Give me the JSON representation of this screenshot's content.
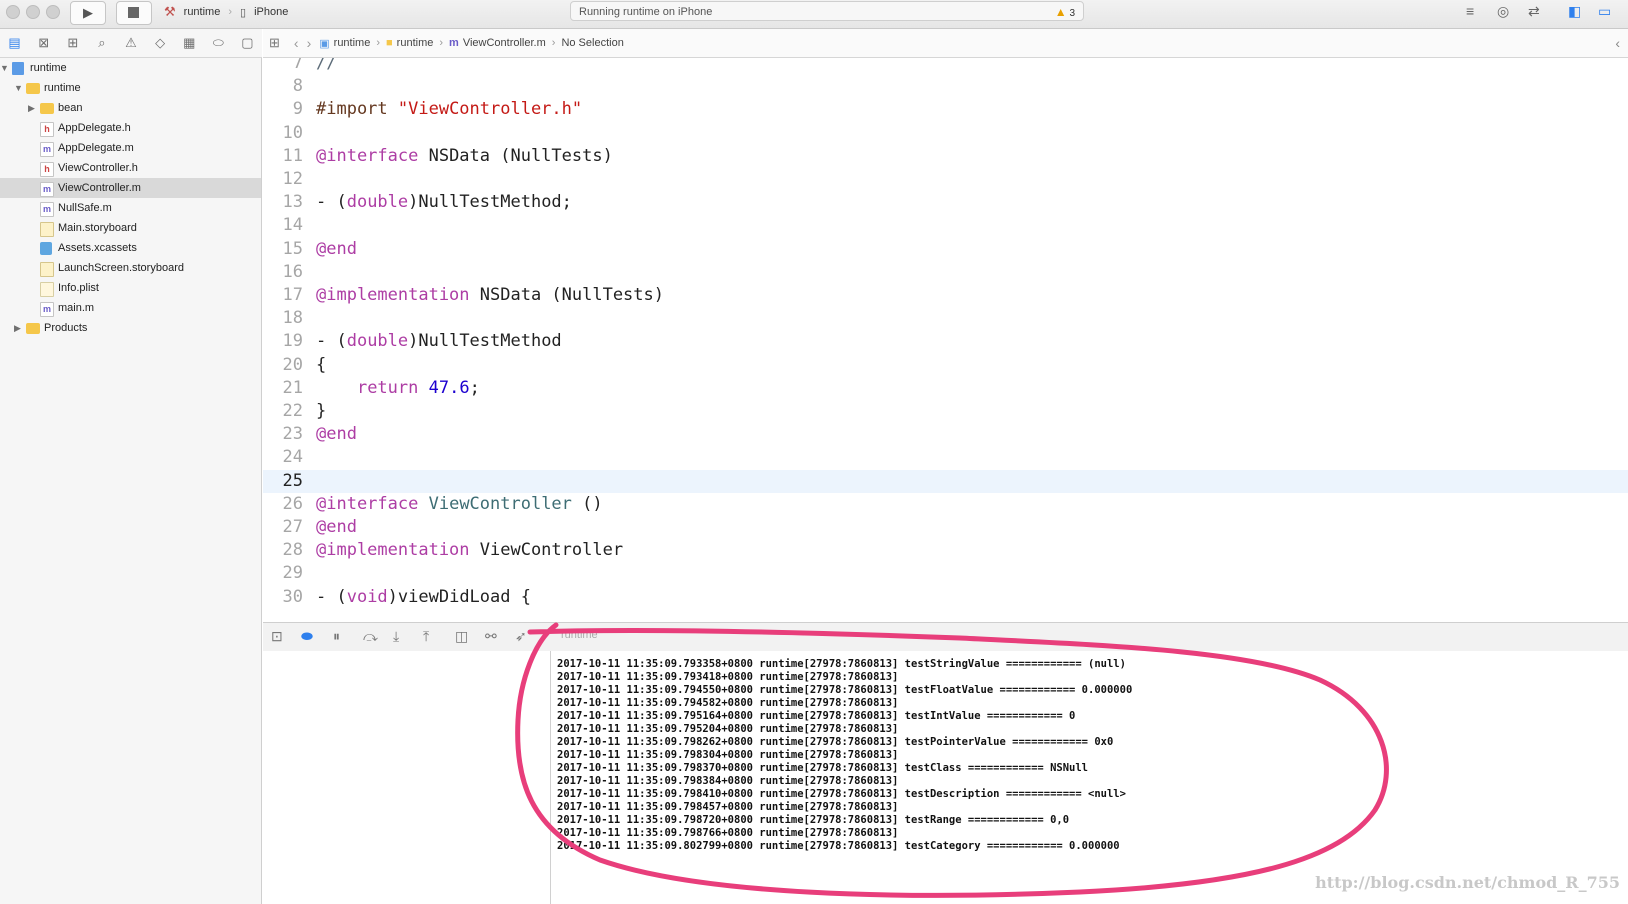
{
  "toolbar": {
    "scheme": "runtime",
    "device": "iPhone",
    "activity": "Running runtime on iPhone",
    "warnings": "3"
  },
  "navigator": {
    "items": [
      {
        "label": "runtime",
        "icon": "project-icon",
        "kind": "proj",
        "indent": 0,
        "disclosure": "▼",
        "selected": false
      },
      {
        "label": "runtime",
        "icon": "folder-icon",
        "kind": "folder",
        "indent": 1,
        "disclosure": "▼",
        "selected": false
      },
      {
        "label": "bean",
        "icon": "folder-icon",
        "kind": "folder",
        "indent": 2,
        "disclosure": "▶",
        "selected": false
      },
      {
        "label": "AppDelegate.h",
        "icon": "header-file-icon",
        "kind": "h",
        "glyph": "h",
        "indent": 2,
        "selected": false
      },
      {
        "label": "AppDelegate.m",
        "icon": "objc-file-icon",
        "kind": "m",
        "glyph": "m",
        "indent": 2,
        "selected": false
      },
      {
        "label": "ViewController.h",
        "icon": "header-file-icon",
        "kind": "h",
        "glyph": "h",
        "indent": 2,
        "selected": false
      },
      {
        "label": "ViewController.m",
        "icon": "objc-file-icon",
        "kind": "m",
        "glyph": "m",
        "indent": 2,
        "selected": true
      },
      {
        "label": "NullSafe.m",
        "icon": "objc-file-icon",
        "kind": "m",
        "glyph": "m",
        "indent": 2,
        "selected": false
      },
      {
        "label": "Main.storyboard",
        "icon": "storyboard-icon",
        "kind": "sb",
        "indent": 2,
        "selected": false
      },
      {
        "label": "Assets.xcassets",
        "icon": "asset-catalog-icon",
        "kind": "assets",
        "indent": 2,
        "selected": false
      },
      {
        "label": "LaunchScreen.storyboard",
        "icon": "storyboard-icon",
        "kind": "sb",
        "indent": 2,
        "selected": false
      },
      {
        "label": "Info.plist",
        "icon": "plist-icon",
        "kind": "plist",
        "indent": 2,
        "selected": false
      },
      {
        "label": "main.m",
        "icon": "objc-file-icon",
        "kind": "m",
        "glyph": "m",
        "indent": 2,
        "selected": false
      },
      {
        "label": "Products",
        "icon": "folder-icon",
        "kind": "folder",
        "indent": 1,
        "disclosure": "▶",
        "selected": false
      }
    ]
  },
  "jumpbar": {
    "crumbs": [
      "runtime",
      "runtime",
      "ViewController.m",
      "No Selection"
    ]
  },
  "editor": {
    "current_line": 25,
    "lines": [
      {
        "n": 7,
        "tokens": [
          {
            "t": "//",
            "c": "cm"
          }
        ]
      },
      {
        "n": 8,
        "tokens": []
      },
      {
        "n": 9,
        "tokens": [
          {
            "t": "#import ",
            "c": "prep"
          },
          {
            "t": "\"ViewController.h\"",
            "c": "str"
          }
        ]
      },
      {
        "n": 10,
        "tokens": []
      },
      {
        "n": 11,
        "tokens": [
          {
            "t": "@interface",
            "c": "kw"
          },
          {
            "t": " NSData (NullTests)",
            "c": ""
          }
        ]
      },
      {
        "n": 12,
        "tokens": []
      },
      {
        "n": 13,
        "tokens": [
          {
            "t": "- (",
            "c": ""
          },
          {
            "t": "double",
            "c": "kw"
          },
          {
            "t": ")NullTestMethod;",
            "c": ""
          }
        ]
      },
      {
        "n": 14,
        "tokens": []
      },
      {
        "n": 15,
        "tokens": [
          {
            "t": "@end",
            "c": "kw"
          }
        ]
      },
      {
        "n": 16,
        "tokens": []
      },
      {
        "n": 17,
        "tokens": [
          {
            "t": "@implementation",
            "c": "kw"
          },
          {
            "t": " NSData (NullTests)",
            "c": ""
          }
        ]
      },
      {
        "n": 18,
        "tokens": []
      },
      {
        "n": 19,
        "tokens": [
          {
            "t": "- (",
            "c": ""
          },
          {
            "t": "double",
            "c": "kw"
          },
          {
            "t": ")NullTestMethod",
            "c": ""
          }
        ]
      },
      {
        "n": 20,
        "tokens": [
          {
            "t": "{",
            "c": ""
          }
        ]
      },
      {
        "n": 21,
        "tokens": [
          {
            "t": "    ",
            "c": ""
          },
          {
            "t": "return",
            "c": "kw"
          },
          {
            "t": " ",
            "c": ""
          },
          {
            "t": "47.6",
            "c": "num"
          },
          {
            "t": ";",
            "c": ""
          }
        ]
      },
      {
        "n": 22,
        "tokens": [
          {
            "t": "}",
            "c": ""
          }
        ]
      },
      {
        "n": 23,
        "tokens": [
          {
            "t": "@end",
            "c": "kw"
          }
        ]
      },
      {
        "n": 24,
        "tokens": []
      },
      {
        "n": 25,
        "tokens": []
      },
      {
        "n": 26,
        "tokens": [
          {
            "t": "@interface",
            "c": "kw"
          },
          {
            "t": " ",
            "c": ""
          },
          {
            "t": "ViewController",
            "c": "cls"
          },
          {
            "t": " ()",
            "c": ""
          }
        ]
      },
      {
        "n": 27,
        "tokens": [
          {
            "t": "@end",
            "c": "kw"
          }
        ]
      },
      {
        "n": 28,
        "tokens": [
          {
            "t": "@implementation",
            "c": "kw"
          },
          {
            "t": " ViewController",
            "c": ""
          }
        ]
      },
      {
        "n": 29,
        "tokens": []
      },
      {
        "n": 30,
        "tokens": [
          {
            "t": "- (",
            "c": ""
          },
          {
            "t": "void",
            "c": "kw"
          },
          {
            "t": ")viewDidLoad {",
            "c": ""
          }
        ]
      }
    ]
  },
  "debugbar": {
    "process": "runtime"
  },
  "console": {
    "lines": [
      "2017-10-11 11:35:09.793358+0800 runtime[27978:7860813] testStringValue ============ (null)",
      "2017-10-11 11:35:09.793418+0800 runtime[27978:7860813]",
      "2017-10-11 11:35:09.794550+0800 runtime[27978:7860813] testFloatValue ============ 0.000000",
      "2017-10-11 11:35:09.794582+0800 runtime[27978:7860813]",
      "2017-10-11 11:35:09.795164+0800 runtime[27978:7860813] testIntValue ============ 0",
      "2017-10-11 11:35:09.795204+0800 runtime[27978:7860813]",
      "2017-10-11 11:35:09.798262+0800 runtime[27978:7860813] testPointerValue ============ 0x0",
      "2017-10-11 11:35:09.798304+0800 runtime[27978:7860813]",
      "2017-10-11 11:35:09.798370+0800 runtime[27978:7860813] testClass ============ NSNull",
      "2017-10-11 11:35:09.798384+0800 runtime[27978:7860813]",
      "2017-10-11 11:35:09.798410+0800 runtime[27978:7860813] testDescription ============ <null>",
      "2017-10-11 11:35:09.798457+0800 runtime[27978:7860813]",
      "2017-10-11 11:35:09.798720+0800 runtime[27978:7860813] testRange ============ 0,0",
      "2017-10-11 11:35:09.798766+0800 runtime[27978:7860813]",
      "2017-10-11 11:35:09.802799+0800 runtime[27978:7860813] testCategory ============ 0.000000"
    ],
    "watermark": "http://blog.csdn.net/chmod_R_755"
  },
  "colors": {
    "annotation": "#e83e7b",
    "keyword": "#ad3da4",
    "string": "#c41a16",
    "number": "#1c00cf",
    "current_line": "#ecf4fd"
  }
}
